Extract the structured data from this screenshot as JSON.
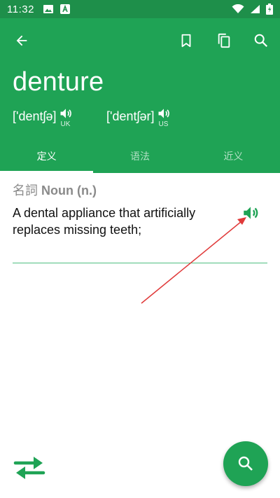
{
  "status_bar": {
    "time": "11:32",
    "left_icons": [
      "image-icon",
      "a-badge-icon"
    ],
    "right_icons": [
      "wifi-icon",
      "signal-icon",
      "battery-icon"
    ]
  },
  "app_bar": {
    "actions": [
      "back-icon",
      "bookmark-icon",
      "copy-icon",
      "search-icon"
    ]
  },
  "word": {
    "title": "denture",
    "pronunciations": [
      {
        "ipa": "['dentʃə]",
        "region": "UK"
      },
      {
        "ipa": "['dentʃər]",
        "region": "US"
      }
    ]
  },
  "tabs": [
    {
      "label": "定义",
      "active": true
    },
    {
      "label": "语法",
      "active": false
    },
    {
      "label": "近义",
      "active": false
    }
  ],
  "entry": {
    "pos_zh": "名詞",
    "pos_en": "Noun (n.)",
    "definition": "A dental appliance that artificially replaces missing teeth;"
  },
  "colors": {
    "primary": "#1fa355",
    "status_bar": "#1e8f4a",
    "accent_arrow": "#e03a3a",
    "divider": "#4fbf80",
    "pos_text": "#8a8a8a"
  }
}
